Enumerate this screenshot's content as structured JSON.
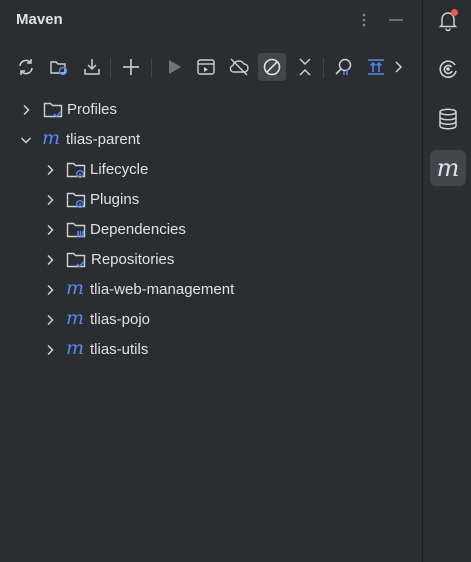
{
  "panel": {
    "title": "Maven"
  },
  "tree": {
    "profiles": "Profiles",
    "root": "tlias-parent",
    "children": {
      "lifecycle": "Lifecycle",
      "plugins": "Plugins",
      "dependencies": "Dependencies",
      "repositories": "Repositories",
      "web_management": "tlia-web-management",
      "pojo": "tlias-pojo",
      "utils": "tlias-utils"
    }
  },
  "rightbar_maven_glyph": "m",
  "colors": {
    "background": "#2b2d30",
    "text": "#dfe1e5",
    "icon": "#ced0d6",
    "maven_blue": "#548af7",
    "notification_dot": "#e55b4f"
  }
}
